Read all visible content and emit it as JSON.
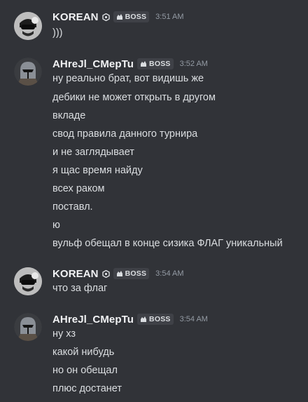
{
  "messages": [
    {
      "author": "KOREAN",
      "tag": "BOSS",
      "time": "3:51 AM",
      "avatar_icon": "masked-face-avatar",
      "lines": [
        ")))"
      ]
    },
    {
      "author": "AHreJl_CMepTu",
      "tag": "BOSS",
      "time": "3:52 AM",
      "avatar_icon": "helmet-avatar",
      "lines": [
        "ну реально брат, вот видишь же",
        "дебики не может открыть в другом",
        "вкладе",
        "свод правила данного турнира",
        "и не заглядывает",
        "я щас время найду",
        "всех раком",
        "поставл.",
        "ю",
        "вульф обещал в конце сизика ФЛАГ уникальный"
      ]
    },
    {
      "author": "KOREAN",
      "tag": "BOSS",
      "time": "3:54 AM",
      "avatar_icon": "masked-face-avatar",
      "lines": [
        "что за флаг"
      ]
    },
    {
      "author": "AHreJl_CMepTu",
      "tag": "BOSS",
      "time": "3:54 AM",
      "avatar_icon": "helmet-avatar",
      "lines": [
        "ну хз",
        "какой нибудь",
        "но он обещал",
        "плюс достанет"
      ]
    }
  ],
  "colors": {
    "background": "#313338",
    "username": "#f2f3f5",
    "text": "#dbdee1",
    "timestamp": "#949ba4",
    "tag_bg": "#3f4147"
  }
}
